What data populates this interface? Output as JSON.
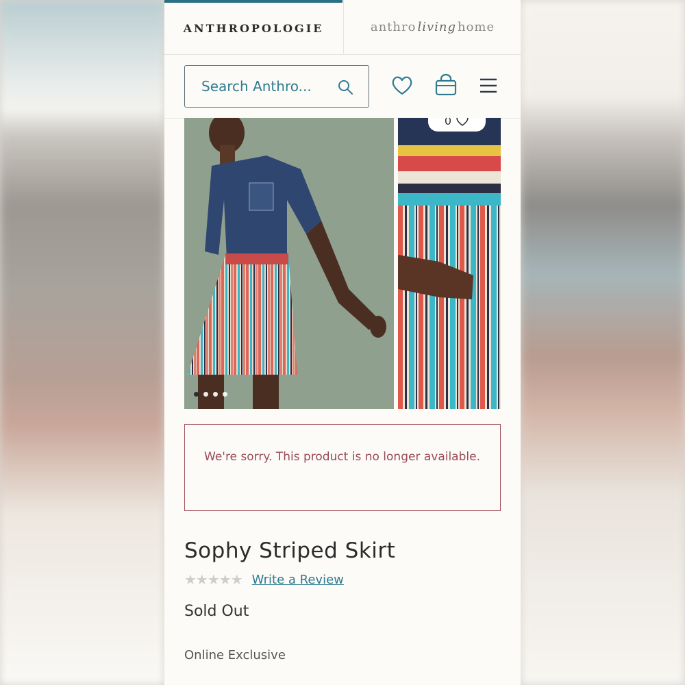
{
  "header": {
    "brand_primary": "ANTHROPOLOGIE",
    "brand_secondary_left": "anthro",
    "brand_secondary_script": "living",
    "brand_secondary_right": "home"
  },
  "search": {
    "placeholder": "Search Anthro..."
  },
  "icons": {
    "search": "search-icon",
    "wishlist": "heart-icon",
    "bag": "shopping-bag-icon",
    "menu": "hamburger-menu-icon"
  },
  "carousel": {
    "wishlist_count": "0",
    "slides_total": 4,
    "active_slide": 1
  },
  "notice": {
    "message": "We're sorry. This product is no longer available."
  },
  "product": {
    "name": "Sophy Striped Skirt",
    "rating": 0,
    "rating_max": 5,
    "review_link": "Write a Review",
    "availability": "Sold Out",
    "tag": "Online Exclusive"
  },
  "colors": {
    "accent_teal": "#2d7b8f",
    "notice_red": "#a5535d",
    "tab_active": "#2a6f82"
  }
}
